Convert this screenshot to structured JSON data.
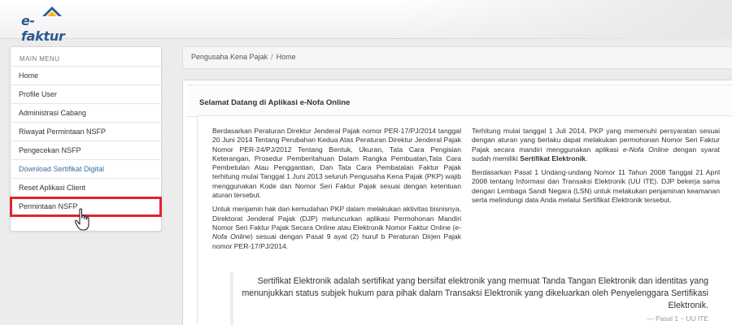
{
  "header": {
    "logo_text": "e-faktur"
  },
  "sidebar": {
    "title": "MAIN MENU",
    "items": [
      {
        "label": "Home"
      },
      {
        "label": "Profile User"
      },
      {
        "label": "Administrasi Cabang"
      },
      {
        "label": "Riwayat Permintaan NSFP"
      },
      {
        "label": "Pengecekan NSFP"
      },
      {
        "label": "Download Sertifikat Digital"
      },
      {
        "label": "Reset Aplikasi Client"
      },
      {
        "label": "Permintaan NSFP"
      }
    ]
  },
  "breadcrumb": {
    "parent": "Pengusaha Kena Pajak",
    "separator": "/",
    "current": "Home"
  },
  "panel": {
    "title": "Selamat Datang di Aplikasi e-Nofa Online",
    "left_p1": "Berdasarkan Peraturan Direktur Jenderal Pajak nomor PER-17/PJ/2014 tanggal 20 Juni 2014 Tentang Perubahan Kedua Atas Peraturan Direktur Jenderal Pajak Nomor PER-24/PJ/2012 Tentang Bentuk, Ukuran, Tata Cara Pengisian Keterangan, Prosedur Pemberitahuan Dalam Rangka Pembuatan,Tata Cara Pembetulan Atau Penggantian, Dan Tata Cara Pembatalan Faktur Pajak terhitung mulai Tanggal 1 Juni 2013 seluruh Pengusaha Kena Pajak (PKP) wajib menggunakan Kode dan Nomor Seri Faktur Pajak sesuai dengan ketentuan aturan tersebut.",
    "left_p2_a": "Untuk menjamin hak dan kemudahan PKP dalam melakukan aktivitas bisnisnya, Direktorat Jenderal Pajak (DJP) meluncurkan aplikasi Permohonan Mandiri Nomor Seri Faktur Pajak Secara Online atau Elektronik Nomor Faktur Online (",
    "left_p2_em": "e-Nofa Online",
    "left_p2_b": ") sesuai dengan Pasal 9 ayat (2) huruf b Peraturan Dirjen Pajak nomor PER-17/PJ/2014.",
    "right_p1_a": "Terhitung mulai tanggal 1 Juli 2014, PKP yang memenuhi persyaratan sesuai dengan aturan yang berlaku dapat melakukan permohonan Nomor Seri Faktur Pajak secara mandiri menggunakan aplikasi ",
    "right_p1_em": "e-Nofa Online",
    "right_p1_b": " dengan syarat sudah memiliki ",
    "right_p1_strong": "Sertifikat Elektronik",
    "right_p1_c": ".",
    "right_p2": "Berdasarkan Pasal 1 Undang-undang Nomor 11 Tahun 2008 Tanggal 21 April 2008 tentang Informasi dan Transaksi Elektronik (UU ITE). DJP bekerja sama dengan Lembaga Sandi Negara (LSN) untuk melakukan penjaminan keamanan serta melindungi data Anda melalui Sertifikat Elektronik tersebut.",
    "quote_text": "Sertifikat Elektronik adalah sertifikat yang bersifat elektronik yang memuat Tanda Tangan Elektronik dan identitas yang menunjukkan status subjek hukum para pihak dalam Transaksi Elektronik yang dikeluarkan oleh Penyelenggara Sertifikasi Elektronik.",
    "quote_source": "— Pasal 1 ~ UU ITE"
  },
  "colors": {
    "highlight": "#e02430",
    "link": "#3b6ea0",
    "logo": "#2c5a8e"
  }
}
